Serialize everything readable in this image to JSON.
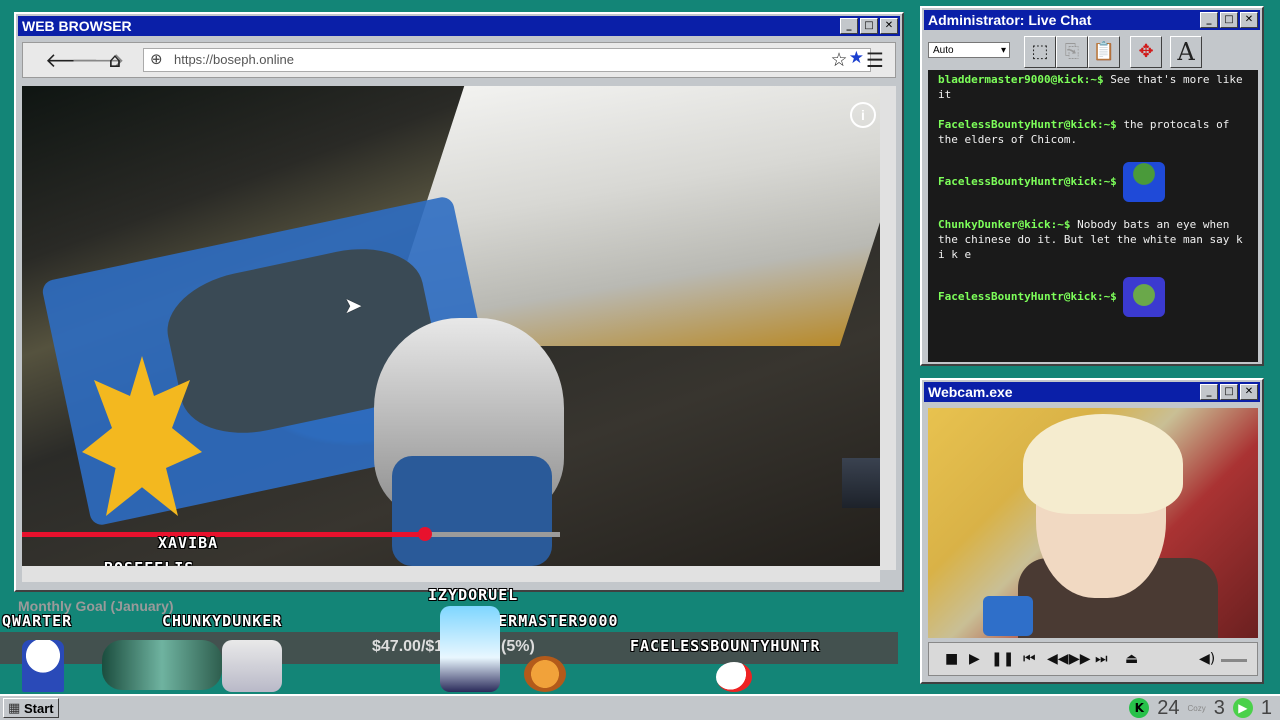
{
  "browser": {
    "title": "WEB BROWSER",
    "url": "https://boseph.online",
    "window_buttons": [
      "_",
      "□",
      "✕"
    ],
    "video_overlay": {
      "names": [
        "XAVIBA",
        "BOSEFELIS"
      ],
      "progress": 0.47
    }
  },
  "chat": {
    "title": "Administrator: Live Chat",
    "font_select": "Auto",
    "messages": [
      {
        "user": "bladdermaster9000@kick:~$",
        "text": "See that's more like it",
        "emote": ""
      },
      {
        "user": "FacelessBountyHuntr@kick:~$",
        "text": "the protocals of the elders of Chicom.",
        "emote": ""
      },
      {
        "user": "FacelessBountyHuntr@kick:~$",
        "text": "",
        "emote": "blue-frog-emote"
      },
      {
        "user": "ChunkyDunker@kick:~$",
        "text": "Nobody bats an eye when the chinese do it. But let the white man say k i k e",
        "emote": ""
      },
      {
        "user": "FacelessBountyHuntr@kick:~$",
        "text": "",
        "emote": "green-frog-emote"
      }
    ]
  },
  "webcam": {
    "title": "Webcam.exe"
  },
  "overlay": {
    "goal_label": "Monthly Goal (January)",
    "goal_amount": "$47.00/$1,000.00 (5%)",
    "viewers": {
      "qwarter": "QWARTER",
      "chunkydunker": "CHUNKYDUNKER",
      "izydoruel": "IZYDORUEL",
      "bladdermaster": "BLADDERMASTER9000",
      "faceless": "FACELESSBOUNTYHUNTR"
    }
  },
  "taskbar": {
    "start_label": "Start",
    "tray_count_a": "24",
    "tray_count_b": "3",
    "tray_count_c": "1",
    "tray_small": "Cozy"
  },
  "colors": {
    "desktop": "#138577",
    "titlebar": "#0a1fa8",
    "chat_user": "#7dff5a",
    "progress": "#e8112d"
  }
}
